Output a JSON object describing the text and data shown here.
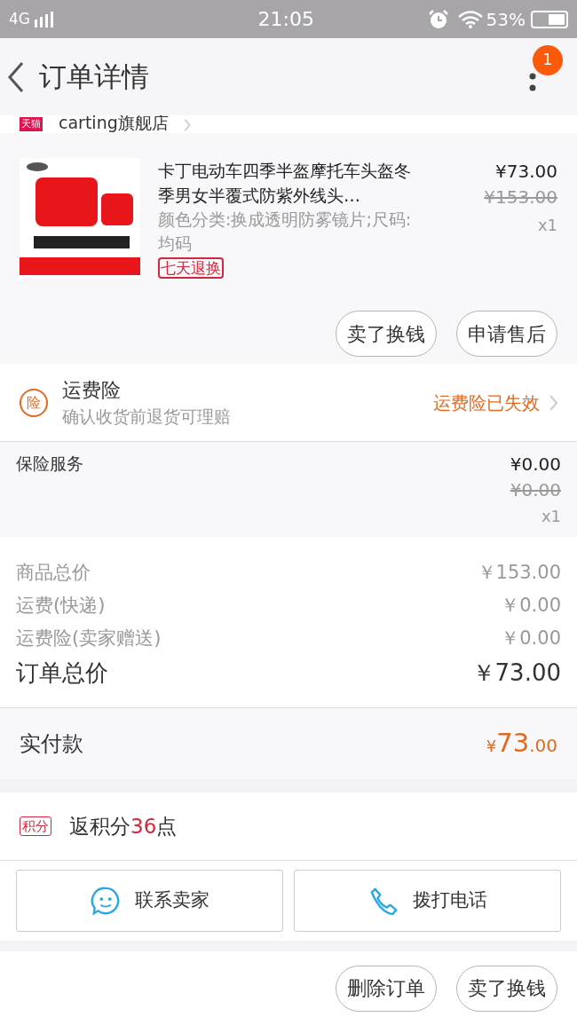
{
  "status_bar": {
    "network": "4G",
    "time": "21:05",
    "battery": "53%"
  },
  "nav": {
    "title": "订单详情",
    "badge": "1"
  },
  "store": {
    "tag": "天猫",
    "name": "carting旗舰店"
  },
  "product": {
    "title": "卡丁电动车四季半盔摩托车头盔冬季男女半覆式防紫外线头…",
    "spec": "颜色分类:换成透明防雾镜片;尺码:均码",
    "tag": "七天退换",
    "price": "¥73.00",
    "original_price": "¥153.00",
    "quantity": "x1",
    "actions": [
      "卖了换钱",
      "申请售后"
    ]
  },
  "shipping_insurance": {
    "icon": "险",
    "title": "运费险",
    "subtitle": "确认收货前退货可理赔",
    "status": "运费险已失效"
  },
  "insurance_service": {
    "name": "保险服务",
    "price": "¥0.00",
    "original_price": "¥0.00",
    "quantity": "x1"
  },
  "summary": [
    {
      "label": "商品总价",
      "value": "￥153.00",
      "kind": "minor"
    },
    {
      "label": "运费(快递)",
      "value": "￥0.00",
      "kind": "minor"
    },
    {
      "label": "运费险(卖家赠送)",
      "value": "￥0.00",
      "kind": "minor"
    },
    {
      "label": "订单总价",
      "value": "￥73.00",
      "kind": "total"
    }
  ],
  "paid": {
    "label": "实付款",
    "currency": "¥",
    "integer": "73",
    "decimal": ".00"
  },
  "points": {
    "tag": "积分",
    "text": "返积分",
    "amount": "36",
    "unit": "点"
  },
  "contact": [
    {
      "label": "联系卖家",
      "kind": "chat"
    },
    {
      "label": "拨打电话",
      "kind": "phone"
    }
  ],
  "bottom_actions": [
    "删除订单",
    "卖了换钱"
  ]
}
